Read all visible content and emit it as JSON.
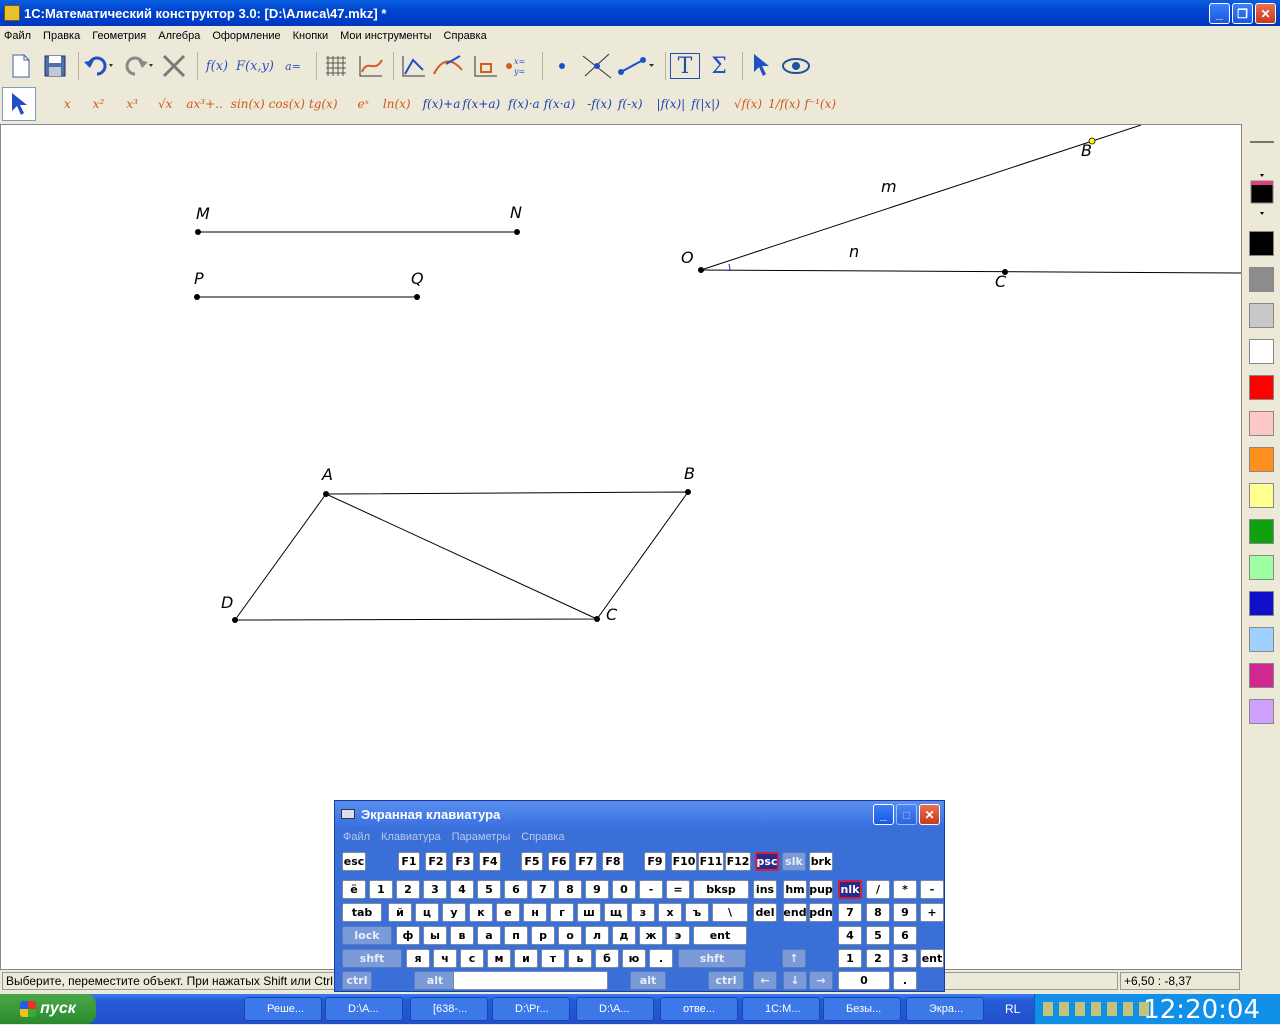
{
  "window": {
    "title": "1С:Математический конструктор 3.0: [D:\\Алиса\\47.mkz] *",
    "minimize": "_",
    "maximize": "❐",
    "close": "✕"
  },
  "menu": [
    "Файл",
    "Правка",
    "Геометрия",
    "Алгебра",
    "Оформление",
    "Кнопки",
    "Мои инструменты",
    "Справка"
  ],
  "toolbar1": {
    "fx": "f(x)",
    "Fxy": "F(x,y)",
    "a_eq": "a=",
    "text_tool": "T",
    "sigma": "Σ"
  },
  "toolbar2": [
    "x",
    "x²",
    "x³",
    "√x",
    "ax³+..",
    "sin(x)",
    "cos(x)",
    "tg(x)",
    "eˣ",
    "ln(x)",
    "f(x)+a",
    "f(x+a)",
    "f(x)·a",
    "f(x·a)",
    "-f(x)",
    "f(-x)",
    "|f(x)|",
    "f(|x|)",
    "√f(x)",
    "1/f(x)",
    "f⁻¹(x)"
  ],
  "canvas": {
    "labels": {
      "M": "M",
      "N": "N",
      "P": "P",
      "Q": "Q",
      "O": "O",
      "B_ray": "B",
      "C_ray": "C",
      "m": "m",
      "n": "n",
      "A": "A",
      "B": "B",
      "C": "C",
      "D": "D"
    }
  },
  "palette": {
    "colors": [
      "#000000",
      "#8c8c8c",
      "#c8c8c8",
      "#ffffff",
      "#ff0000",
      "#ffc8c8",
      "#ff9020",
      "#ffff90",
      "#10a010",
      "#a0ffa0",
      "#1010c8",
      "#a0d0ff",
      "#d02890",
      "#d0a0ff"
    ]
  },
  "status": {
    "text": "Выберите, переместите объект. При нажатых Shift или Ctrl",
    "coords": "+6,50 : -8,37"
  },
  "osk": {
    "title": "Экранная клавиатура",
    "menu": [
      "Файл",
      "Клавиатура",
      "Параметры",
      "Справка"
    ],
    "row_f": [
      "esc",
      "F1",
      "F2",
      "F3",
      "F4",
      "F5",
      "F6",
      "F7",
      "F8",
      "F9",
      "F10",
      "F11",
      "F12",
      "psc",
      "slk",
      "brk"
    ],
    "row1": [
      "ё",
      "1",
      "2",
      "3",
      "4",
      "5",
      "6",
      "7",
      "8",
      "9",
      "0",
      "-",
      "=",
      "bksp",
      "ins",
      "hm",
      "pup",
      "nlk",
      "/",
      "*",
      "-"
    ],
    "row2": [
      "tab",
      "й",
      "ц",
      "у",
      "к",
      "е",
      "н",
      "г",
      "ш",
      "щ",
      "з",
      "х",
      "ъ",
      "\\",
      "del",
      "end",
      "pdn",
      "7",
      "8",
      "9",
      "+"
    ],
    "row3": [
      "lock",
      "ф",
      "ы",
      "в",
      "а",
      "п",
      "р",
      "о",
      "л",
      "д",
      "ж",
      "э",
      "ent",
      "4",
      "5",
      "6"
    ],
    "row4": [
      "shft",
      "я",
      "ч",
      "с",
      "м",
      "и",
      "т",
      "ь",
      "б",
      "ю",
      ".",
      "shft",
      "↑",
      "1",
      "2",
      "3",
      "ent"
    ],
    "row5": [
      "ctrl",
      "alt",
      "alt",
      "ctrl",
      "←",
      "↓",
      "→",
      "0",
      "."
    ]
  },
  "taskbar": {
    "start": "пуск",
    "tasks": [
      "Реше...",
      "D:\\А...",
      "[638-...",
      "D:\\Pr...",
      "D:\\А...",
      "отве...",
      "1С:М...",
      "Безы...",
      "Экра..."
    ],
    "lang": "RL",
    "clock": "12:20:04"
  }
}
